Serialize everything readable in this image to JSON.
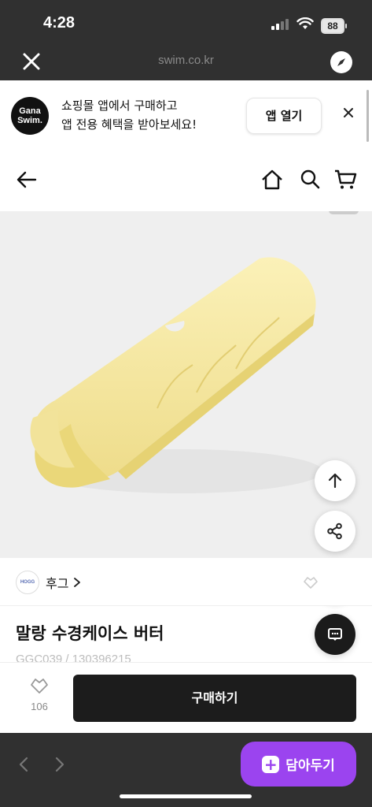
{
  "status_bar": {
    "time": "4:28",
    "battery": "88"
  },
  "browser": {
    "url": "swim.co.kr"
  },
  "app_banner": {
    "logo_line1": "Gana",
    "logo_line2": "Swim.",
    "line1": "쇼핑몰 앱에서 구매하고",
    "line2": "앱 전용 혜택을 받아보세요!",
    "open_button": "앱 열기"
  },
  "brand": {
    "logo_text": "HOGG",
    "name": "후그"
  },
  "product": {
    "title": "말랑 수경케이스 버터",
    "code": "GGC039 / 130396215"
  },
  "action_bar": {
    "like_count": "106",
    "buy_label": "구매하기"
  },
  "toolbar": {
    "save_label": "담아두기"
  },
  "colors": {
    "accent": "#9b44ef",
    "dark": "#1c1c1c",
    "product_yellow": "#f5e9a4"
  }
}
